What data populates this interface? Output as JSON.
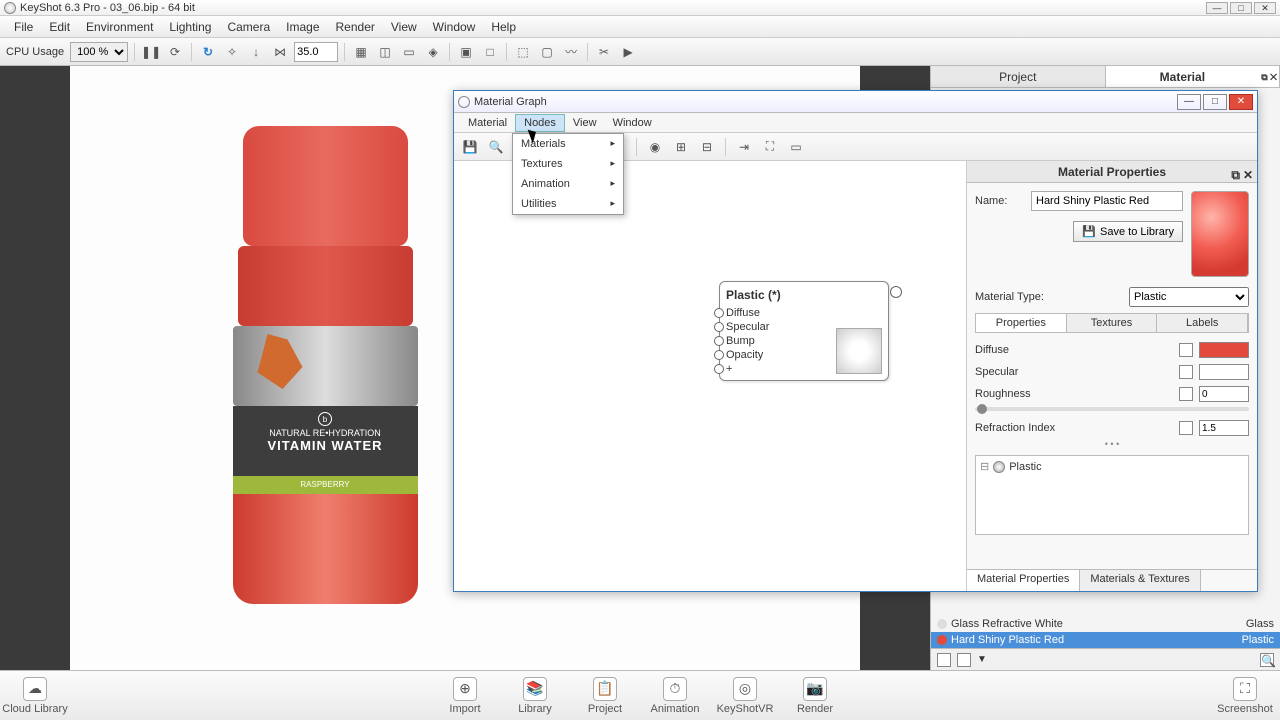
{
  "title": "KeyShot 6.3 Pro - 03_06.bip - 64 bit",
  "menu": [
    "File",
    "Edit",
    "Environment",
    "Lighting",
    "Camera",
    "Image",
    "Render",
    "View",
    "Window",
    "Help"
  ],
  "toolbar": {
    "cpu_label": "CPU Usage",
    "cpu_value": "100 %",
    "num": "35.0"
  },
  "bottle_label": {
    "small": "NATURAL RE•HYDRATION",
    "big": "VITAMIN WATER",
    "flavor": "RASPBERRY"
  },
  "rp_tabs": {
    "project": "Project",
    "material": "Material"
  },
  "matgraph": {
    "title": "Material Graph",
    "menu": [
      "Material",
      "Nodes",
      "View",
      "Window"
    ],
    "dropdown": [
      "Materials",
      "Textures",
      "Animation",
      "Utilities"
    ],
    "node_title": "Plastic (*)",
    "node_ports": [
      "Diffuse",
      "Specular",
      "Bump",
      "Opacity",
      "+"
    ]
  },
  "mp": {
    "header": "Material Properties",
    "name_label": "Name:",
    "name_value": "Hard Shiny Plastic Red",
    "save": "Save to Library",
    "type_label": "Material Type:",
    "type_value": "Plastic",
    "tabs": [
      "Properties",
      "Textures",
      "Labels"
    ],
    "props": {
      "diffuse": "Diffuse",
      "specular": "Specular",
      "rough": "Roughness",
      "rough_val": "0",
      "refr": "Refraction Index",
      "refr_val": "1.5"
    },
    "tree_item": "Plastic",
    "bottom_tabs": [
      "Material Properties",
      "Materials & Textures"
    ]
  },
  "matlist": [
    {
      "name": "Glass Refractive White",
      "type": "Glass",
      "sel": false,
      "color": "#ddd"
    },
    {
      "name": "Hard Shiny Plastic Red",
      "type": "Plastic",
      "sel": true,
      "color": "#e24a3d"
    }
  ],
  "bottom": [
    "Cloud Library",
    "Import",
    "Library",
    "Project",
    "Animation",
    "KeyShotVR",
    "Render",
    "Screenshot"
  ]
}
